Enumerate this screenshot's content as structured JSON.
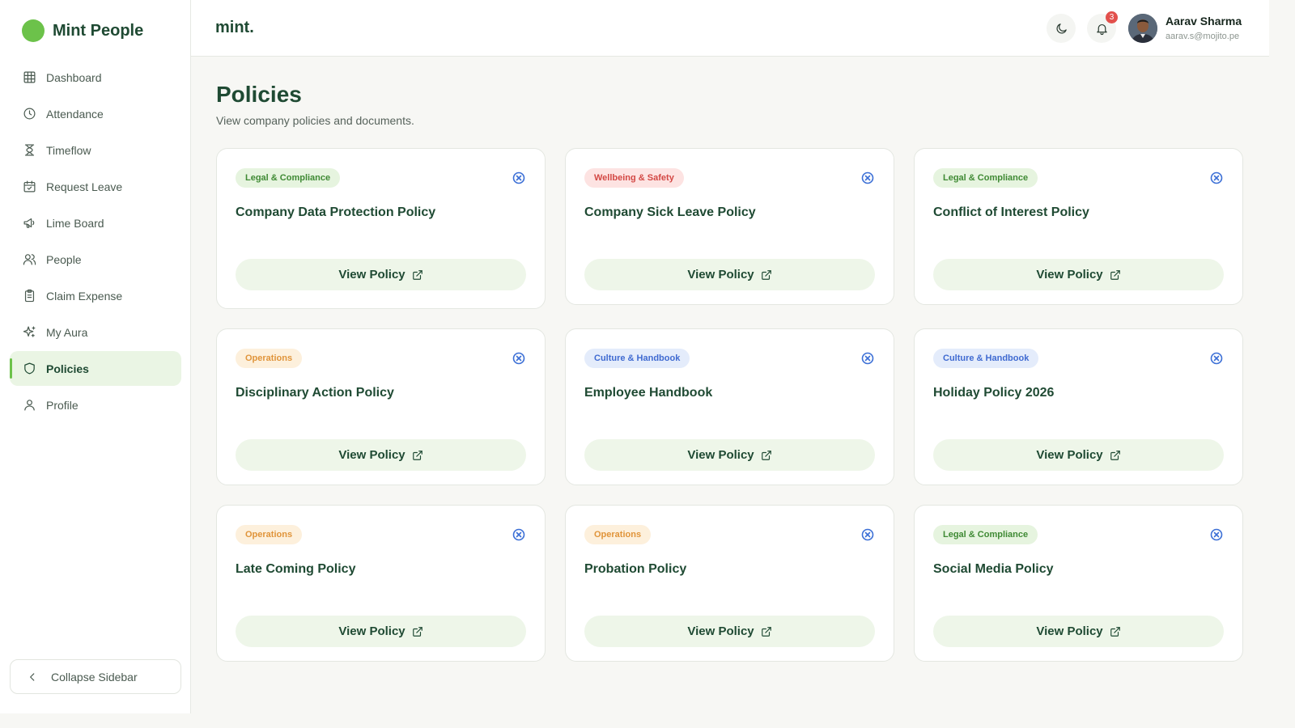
{
  "brand": {
    "name": "Mint People",
    "color": "#6cc24a"
  },
  "sidebar": {
    "items": [
      {
        "label": "Dashboard",
        "icon": "grid-icon"
      },
      {
        "label": "Attendance",
        "icon": "clock-icon"
      },
      {
        "label": "Timeflow",
        "icon": "hourglass-icon"
      },
      {
        "label": "Request Leave",
        "icon": "calendar-check-icon"
      },
      {
        "label": "Lime Board",
        "icon": "megaphone-icon"
      },
      {
        "label": "People",
        "icon": "users-icon"
      },
      {
        "label": "Claim Expense",
        "icon": "clipboard-icon"
      },
      {
        "label": "My Aura",
        "icon": "sparkles-icon"
      },
      {
        "label": "Policies",
        "icon": "shield-icon",
        "active": true
      },
      {
        "label": "Profile",
        "icon": "user-icon"
      }
    ],
    "collapse_label": "Collapse Sidebar"
  },
  "header": {
    "logo": "mint.",
    "notifications_count": "3",
    "user": {
      "name": "Aarav Sharma",
      "email": "aarav.s@mojito.pe"
    }
  },
  "page": {
    "title": "Policies",
    "subtitle": "View company policies and documents."
  },
  "policies": [
    {
      "tag": "Legal & Compliance",
      "tag_type": "legal",
      "title": "Company Data Protection Policy",
      "button": "View Policy"
    },
    {
      "tag": "Wellbeing & Safety",
      "tag_type": "well",
      "title": "Company Sick Leave Policy",
      "button": "View Policy"
    },
    {
      "tag": "Legal & Compliance",
      "tag_type": "legal",
      "title": "Conflict of Interest Policy",
      "button": "View Policy"
    },
    {
      "tag": "Operations",
      "tag_type": "ops",
      "title": "Disciplinary Action Policy",
      "button": "View Policy"
    },
    {
      "tag": "Culture & Handbook",
      "tag_type": "culture",
      "title": "Employee Handbook",
      "button": "View Policy"
    },
    {
      "tag": "Culture & Handbook",
      "tag_type": "culture",
      "title": "Holiday Policy 2026",
      "button": "View Policy"
    },
    {
      "tag": "Operations",
      "tag_type": "ops",
      "title": "Late Coming Policy",
      "button": "View Policy"
    },
    {
      "tag": "Operations",
      "tag_type": "ops",
      "title": "Probation Policy",
      "button": "View Policy"
    },
    {
      "tag": "Legal & Compliance",
      "tag_type": "legal",
      "title": "Social Media Policy",
      "button": "View Policy"
    }
  ],
  "colors": {
    "legal": "#3f8a34",
    "wellbeing": "#d34844",
    "operations": "#e0943a",
    "culture": "#3f6ad1",
    "primary_text": "#1f4a33"
  }
}
